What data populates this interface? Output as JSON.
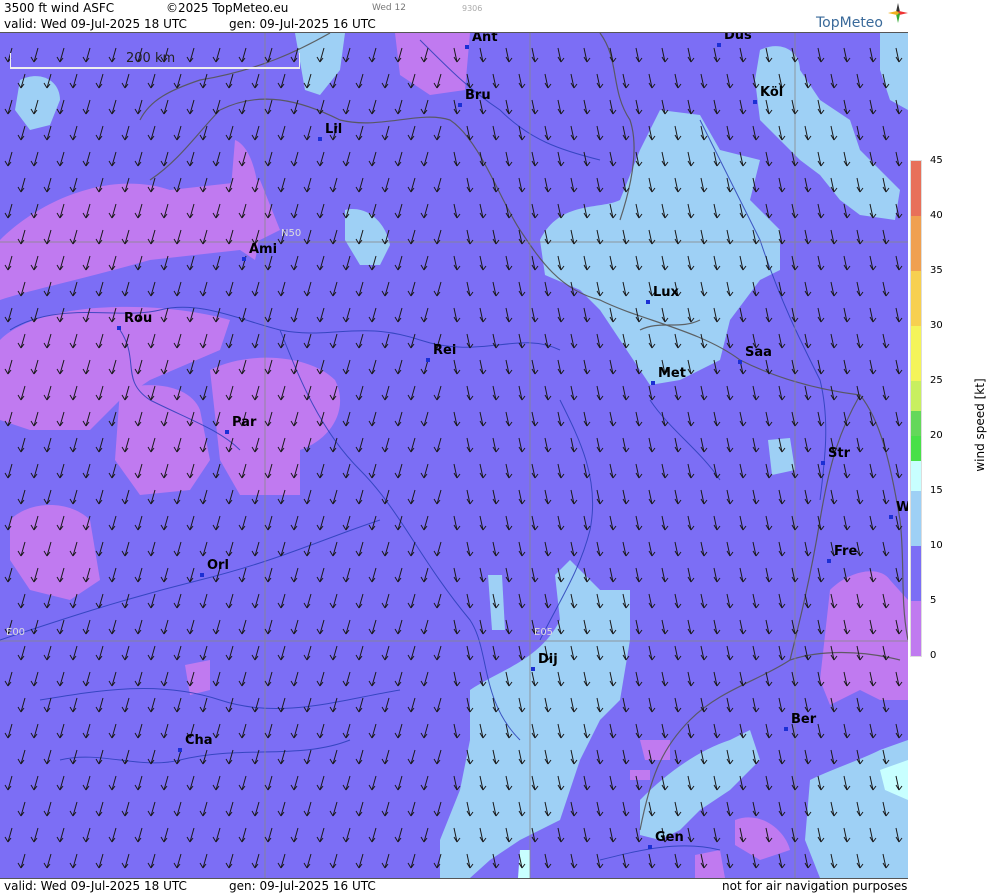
{
  "header": {
    "product": "3500 ft wind ASFC",
    "copyright": "©2025 TopMeteo.eu",
    "slot": "Wed 12",
    "code": "9306",
    "valid": "valid:  Wed  09-Jul-2025  18 UTC",
    "generated": "gen:  09-Jul-2025  16 UTC",
    "logo": "TopMeteo"
  },
  "scale_bar": "200 km",
  "grid_labels": {
    "lat": "N50",
    "lon0": "E00",
    "lon5": "E05"
  },
  "cities": [
    {
      "id": "ant",
      "name": "Ant"
    },
    {
      "id": "dus",
      "name": "Düs"
    },
    {
      "id": "bru",
      "name": "Bru"
    },
    {
      "id": "kol",
      "name": "Köl"
    },
    {
      "id": "lil",
      "name": "Lil"
    },
    {
      "id": "ami",
      "name": "Ami"
    },
    {
      "id": "rou",
      "name": "Rou"
    },
    {
      "id": "rei",
      "name": "Rei"
    },
    {
      "id": "lux",
      "name": "Lux"
    },
    {
      "id": "saa",
      "name": "Saa"
    },
    {
      "id": "met",
      "name": "Met"
    },
    {
      "id": "par",
      "name": "Par"
    },
    {
      "id": "str",
      "name": "Str"
    },
    {
      "id": "w",
      "name": "W"
    },
    {
      "id": "fre",
      "name": "Fre"
    },
    {
      "id": "orl",
      "name": "Orl"
    },
    {
      "id": "dij",
      "name": "Dij"
    },
    {
      "id": "ber",
      "name": "Ber"
    },
    {
      "id": "cha",
      "name": "Cha"
    },
    {
      "id": "gen",
      "name": "Gen"
    }
  ],
  "footer": {
    "valid": "valid:  Wed  09-Jul-2025  18 UTC",
    "generated": "gen:  09-Jul-2025  16 UTC",
    "disclaimer": "not for air navigation purposes"
  },
  "legend": {
    "title": "wind  speed  [kt]",
    "ticks": [
      "45",
      "40",
      "35",
      "30",
      "25",
      "20",
      "15",
      "10",
      "5",
      "0"
    ],
    "colors": [
      "#e8705a",
      "#f0a050",
      "#f7d050",
      "#f4f45a",
      "#c8ef60",
      "#64d85a",
      "#48e048",
      "#c8ffff",
      "#9ed0f5",
      "#7c6ef5",
      "#c07af0"
    ]
  }
}
